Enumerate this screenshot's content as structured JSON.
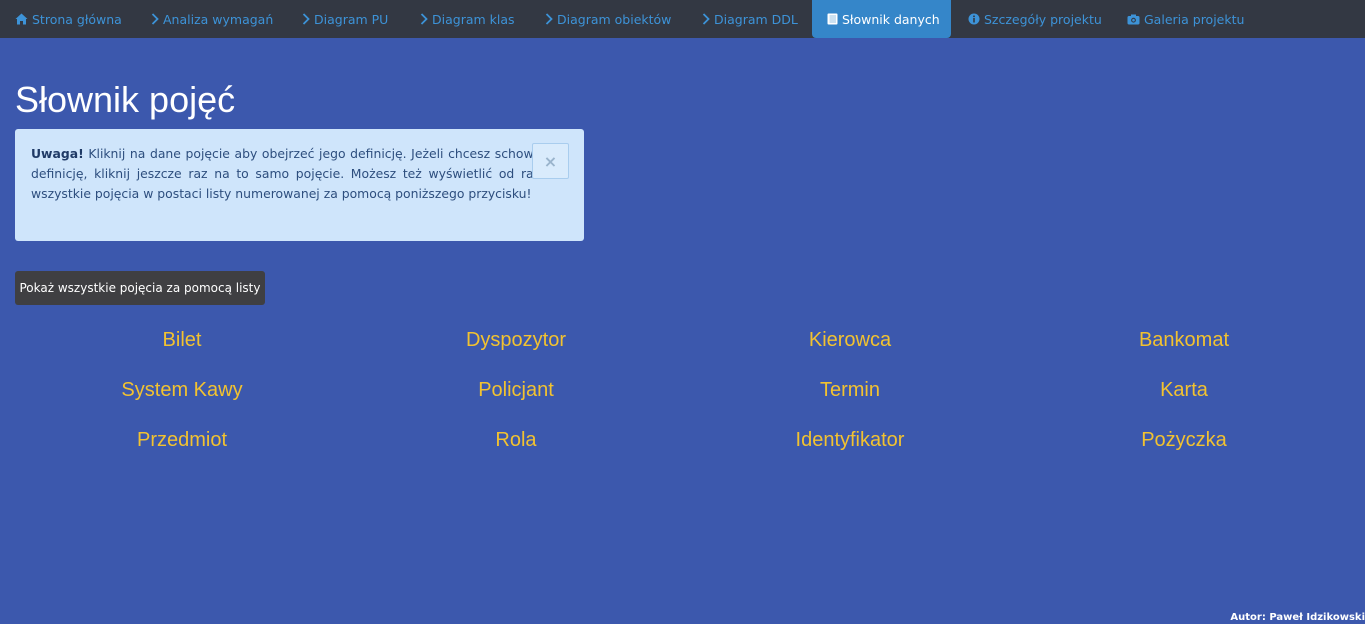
{
  "nav": {
    "items": [
      {
        "label": "Strona główna",
        "icon": "home-icon"
      },
      {
        "label": "Analiza wymagań",
        "icon": "chevron-right-icon"
      },
      {
        "label": "Diagram PU",
        "icon": "chevron-right-icon"
      },
      {
        "label": "Diagram klas",
        "icon": "chevron-right-icon"
      },
      {
        "label": "Diagram obiektów",
        "icon": "chevron-right-icon"
      },
      {
        "label": "Diagram DDL",
        "icon": "chevron-right-icon"
      },
      {
        "label": "Słownik danych",
        "icon": "book-icon",
        "active": true
      },
      {
        "label": "Szczegóły projektu",
        "icon": "info-circle-icon"
      },
      {
        "label": "Galeria projektu",
        "icon": "camera-icon"
      }
    ]
  },
  "page": {
    "title": "Słownik pojęć"
  },
  "alert": {
    "strong": "Uwaga!",
    "text": " Kliknij na dane pojęcie aby obejrzeć jego definicję. Jeżeli chcesz schować definicję, kliknij jeszcze raz na to samo pojęcie. Możesz też wyświetlić od razu wszystkie pojęcia w postaci listy numerowanej za pomocą poniższego przycisku!",
    "close_symbol": "×"
  },
  "button": {
    "show_all_label": "Pokaż wszystkie pojęcia za pomocą listy"
  },
  "terms": [
    "Bilet",
    "Dyspozytor",
    "Kierowca",
    "Bankomat",
    "System Kawy",
    "Policjant",
    "Termin",
    "Karta",
    "Przedmiot",
    "Rola",
    "Identyfikator",
    "Pożyczka"
  ],
  "footer": {
    "author": "Autor: Paweł Idzikowski"
  },
  "colors": {
    "background": "#3c58ad",
    "navbar": "#333843",
    "nav_link": "#3d93d8",
    "nav_active": "#3586c9",
    "term_text": "#f2c230",
    "alert_bg": "#cfe5fb"
  }
}
